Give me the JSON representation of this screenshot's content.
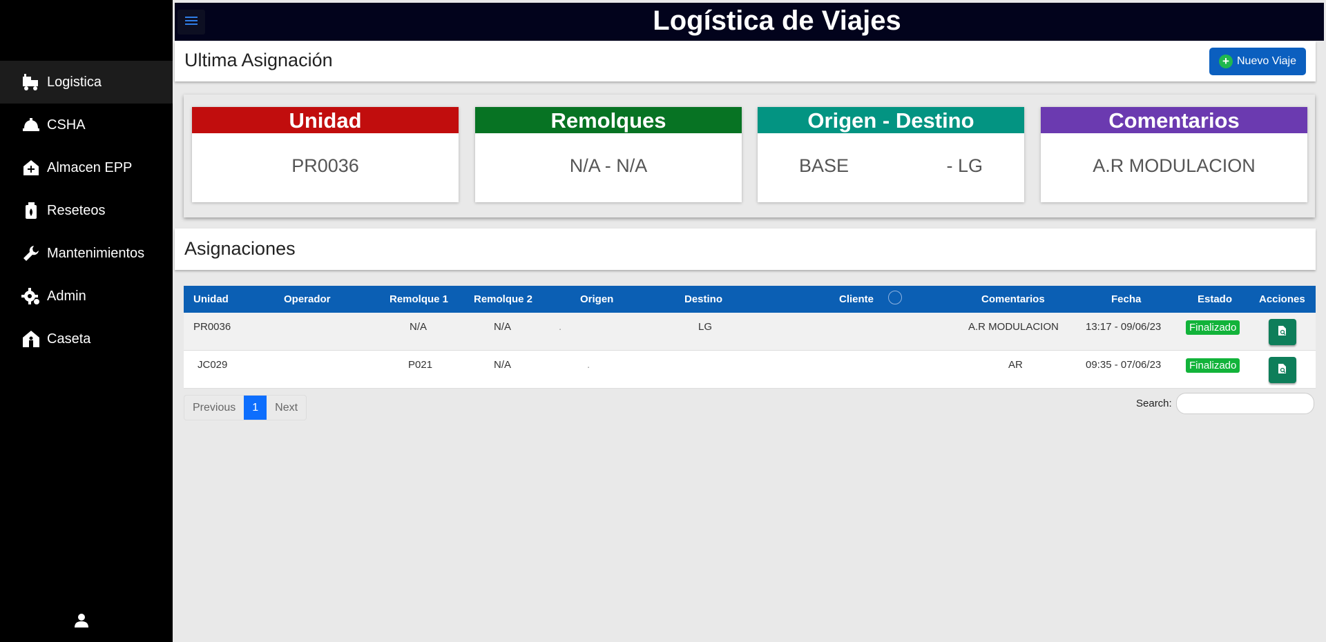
{
  "sidebar": {
    "items": [
      {
        "label": "Logistica",
        "icon": "truck-icon",
        "active": true
      },
      {
        "label": "CSHA",
        "icon": "hardhat-icon",
        "active": false
      },
      {
        "label": "Almacen EPP",
        "icon": "warehouse-plus-icon",
        "active": false
      },
      {
        "label": "Reseteos",
        "icon": "reset-icon",
        "active": false
      },
      {
        "label": "Mantenimientos",
        "icon": "wrench-icon",
        "active": false
      },
      {
        "label": "Admin",
        "icon": "gear-icon",
        "active": false
      },
      {
        "label": "Caseta",
        "icon": "guardhouse-icon",
        "active": false
      }
    ],
    "user_icon": "user-icon"
  },
  "header": {
    "title": "Logística de Viajes",
    "menu_icon": "menu-icon"
  },
  "last_assignment": {
    "title": "Ultima Asignación",
    "new_button": "Nuevo Viaje",
    "cards": [
      {
        "title": "Unidad",
        "value": "PR0036",
        "color": "#c10d0d"
      },
      {
        "title": "Remolques",
        "value": "N/A - N/A",
        "color": "#077323"
      },
      {
        "title": "Origen - Destino",
        "value_left": "BASE",
        "value_right": "- LG",
        "color": "#039482"
      },
      {
        "title": "Comentarios",
        "value": "A.R MODULACION",
        "color": "#6b3ab0"
      }
    ]
  },
  "assignments": {
    "title": "Asignaciones",
    "columns": [
      "Unidad",
      "Operador",
      "Remolque 1",
      "Remolque 2",
      "Origen",
      "Destino",
      "Cliente",
      "Comentarios",
      "Fecha",
      "Estado",
      "Acciones"
    ],
    "rows": [
      {
        "unidad": "PR0036",
        "operador": "",
        "remolque1": "N/A",
        "remolque2": "N/A",
        "origen": ".",
        "destino": "LG",
        "cliente": "",
        "comentarios": "A.R MODULACION",
        "fecha": "13:17 - 09/06/23",
        "estado": "Finalizado"
      },
      {
        "unidad": "JC029",
        "operador": "",
        "remolque1": "P021",
        "remolque2": "N/A",
        "origen": ".",
        "destino": "",
        "cliente": "",
        "comentarios": "AR",
        "fecha": "09:35 - 07/06/23",
        "estado": "Finalizado"
      }
    ]
  },
  "pagination": {
    "previous": "Previous",
    "current": "1",
    "next": "Next"
  },
  "search": {
    "label": "Search:",
    "value": ""
  }
}
